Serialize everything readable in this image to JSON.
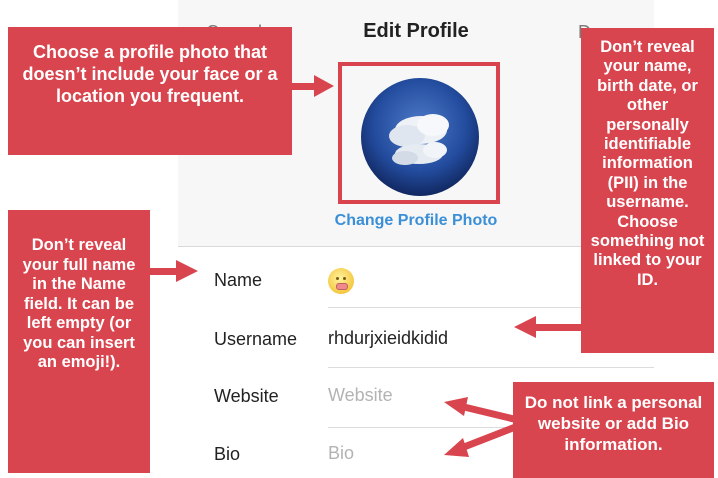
{
  "nav": {
    "cancel": "Cancel",
    "title": "Edit Profile",
    "done": "Done"
  },
  "profile": {
    "change_photo": "Change Profile Photo"
  },
  "form": {
    "name": {
      "label": "Name",
      "value_icon": "emoji-smiley-icon"
    },
    "username": {
      "label": "Username",
      "value": "rhdurjxieidkidid"
    },
    "website": {
      "label": "Website",
      "placeholder": "Website"
    },
    "bio": {
      "label": "Bio",
      "placeholder": "Bio"
    }
  },
  "callouts": {
    "photo": "Choose a profile photo that doesn’t include your face or a location you frequent.",
    "name": "Don’t reveal your full name in the Name field. It can be left empty (or you can insert an emoji!).",
    "username": "Don’t reveal your name, birth date, or other personally identifiable information (PII) in the username. Choose something not linked to your ID.",
    "website_bio": "Do not link a personal website or add Bio information."
  },
  "colors": {
    "callout": "#d9454e",
    "link": "#3b8fd6",
    "avatar_sky": "#1f3d8a"
  }
}
